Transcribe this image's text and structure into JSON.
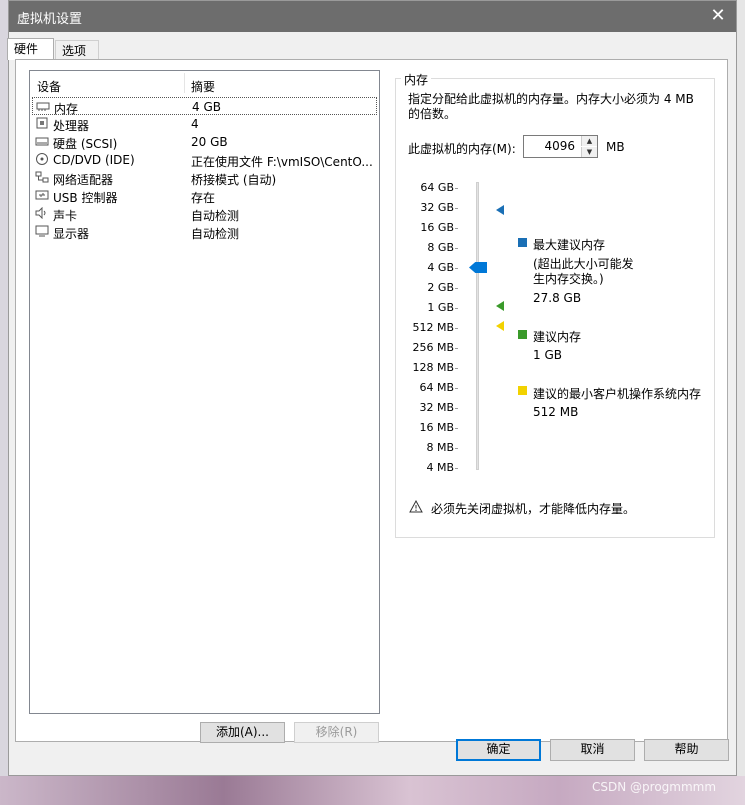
{
  "window": {
    "title": "虚拟机设置",
    "close_label": "✕"
  },
  "tabs": [
    {
      "label": "硬件"
    },
    {
      "label": "选项"
    }
  ],
  "device_list": {
    "columns": [
      "设备",
      "摘要"
    ],
    "rows": [
      {
        "icon": "memory-icon",
        "name": "内存",
        "summary": "4 GB"
      },
      {
        "icon": "cpu-icon",
        "name": "处理器",
        "summary": "4"
      },
      {
        "icon": "disk-icon",
        "name": "硬盘 (SCSI)",
        "summary": "20 GB"
      },
      {
        "icon": "cd-dvd-icon",
        "name": "CD/DVD (IDE)",
        "summary": "正在使用文件 F:\\vmISO\\CentO..."
      },
      {
        "icon": "network-icon",
        "name": "网络适配器",
        "summary": "桥接模式 (自动)"
      },
      {
        "icon": "usb-icon",
        "name": "USB 控制器",
        "summary": "存在"
      },
      {
        "icon": "sound-icon",
        "name": "声卡",
        "summary": "自动检测"
      },
      {
        "icon": "display-icon",
        "name": "显示器",
        "summary": "自动检测"
      }
    ],
    "selected_index": 0
  },
  "list_buttons": {
    "add": "添加(A)...",
    "remove": "移除(R)"
  },
  "memory": {
    "group_title": "内存",
    "description": "指定分配给此虚拟机的内存量。内存大小必须为 4 MB 的倍数。",
    "field_label": "此虚拟机的内存(M):",
    "value": "4096",
    "unit": "MB",
    "scale_labels": [
      "64 GB",
      "32 GB",
      "16 GB",
      "8 GB",
      "4 GB",
      "2 GB",
      "1 GB",
      "512 MB",
      "256 MB",
      "128 MB",
      "64 MB",
      "32 MB",
      "16 MB",
      "8 MB",
      "4 MB"
    ],
    "legend": {
      "max": {
        "title": "最大建议内存",
        "note": "(超出此大小可能发生内存交换。)",
        "value": "27.8 GB",
        "color": "#1a6fb5"
      },
      "recommended": {
        "title": "建议内存",
        "value": "1 GB",
        "color": "#3a9a2a"
      },
      "min_guest": {
        "title": "建议的最小客户机操作系统内存",
        "value": "512 MB",
        "color": "#f2d200"
      }
    },
    "slider_color": "#0078d7",
    "warning": "必须先关闭虚拟机，才能降低内存量。"
  },
  "footer_buttons": {
    "ok": "确定",
    "cancel": "取消",
    "help": "帮助"
  },
  "watermark": "CSDN @progmmmm"
}
